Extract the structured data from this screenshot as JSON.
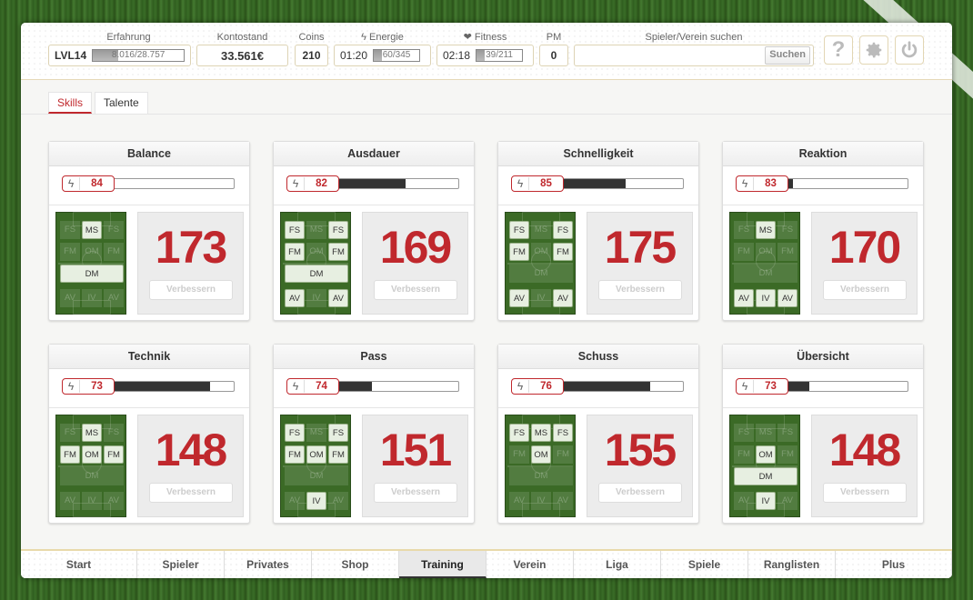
{
  "header": {
    "erfahrung": {
      "label": "Erfahrung",
      "level": "LVL14",
      "bar_text": "8.016/28.757",
      "progress": 0.279
    },
    "kontostand": {
      "label": "Kontostand",
      "value": "33.561€"
    },
    "coins": {
      "label": "Coins",
      "value": "210"
    },
    "energie": {
      "label": "Energie",
      "icon": "lightning-icon",
      "time": "01:20",
      "bar_text": "60/345",
      "progress": 0.174
    },
    "fitness": {
      "label": "Fitness",
      "icon": "heart-icon",
      "time": "02:18",
      "bar_text": "39/211",
      "progress": 0.185
    },
    "pm": {
      "label": "PM",
      "value": "0"
    },
    "search": {
      "label": "Spieler/Verein suchen",
      "value": "",
      "button": "Suchen"
    },
    "icons": [
      "help-icon",
      "settings-gear-icon",
      "power-icon"
    ]
  },
  "subtabs": [
    {
      "label": "Skills",
      "active": true
    },
    {
      "label": "Talente",
      "active": false
    }
  ],
  "improve_label": "Verbessern",
  "skills": [
    {
      "title": "Balance",
      "level": "84",
      "progress": 0.05,
      "value": "173",
      "positions": {
        "LF": false,
        "MS": true,
        "RF": false,
        "LM": false,
        "OM": false,
        "RM": false,
        "DM": true,
        "LV": false,
        "IV": false,
        "RV": false
      }
    },
    {
      "title": "Ausdauer",
      "level": "82",
      "progress": 0.58,
      "value": "169",
      "positions": {
        "LF": true,
        "MS": false,
        "RF": true,
        "LM": true,
        "OM": false,
        "RM": true,
        "DM": true,
        "LV": true,
        "IV": false,
        "RV": true
      }
    },
    {
      "title": "Schnelligkeit",
      "level": "85",
      "progress": 0.54,
      "value": "175",
      "positions": {
        "LF": true,
        "MS": false,
        "RF": true,
        "LM": true,
        "OM": false,
        "RM": true,
        "DM": false,
        "LV": true,
        "IV": false,
        "RV": true
      }
    },
    {
      "title": "Reaktion",
      "level": "83",
      "progress": 0.09,
      "value": "170",
      "positions": {
        "LF": false,
        "MS": true,
        "RF": false,
        "LM": false,
        "OM": false,
        "RM": false,
        "DM": false,
        "LV": true,
        "IV": true,
        "RV": true
      }
    },
    {
      "title": "Technik",
      "level": "73",
      "progress": 0.81,
      "value": "148",
      "positions": {
        "LF": false,
        "MS": true,
        "RF": false,
        "LM": true,
        "OM": true,
        "RM": true,
        "DM": false,
        "LV": false,
        "IV": false,
        "RV": false
      }
    },
    {
      "title": "Pass",
      "level": "74",
      "progress": 0.31,
      "value": "151",
      "positions": {
        "LF": true,
        "MS": false,
        "RF": true,
        "LM": true,
        "OM": true,
        "RM": true,
        "DM": false,
        "LV": false,
        "IV": true,
        "RV": false
      }
    },
    {
      "title": "Schuss",
      "level": "76",
      "progress": 0.74,
      "value": "155",
      "positions": {
        "LF": true,
        "MS": true,
        "RF": true,
        "LM": false,
        "OM": true,
        "RM": false,
        "DM": false,
        "LV": false,
        "IV": false,
        "RV": false
      }
    },
    {
      "title": "Übersicht",
      "level": "73",
      "progress": 0.22,
      "value": "148",
      "positions": {
        "LF": false,
        "MS": false,
        "RF": false,
        "LM": false,
        "OM": true,
        "RM": false,
        "DM": true,
        "LV": false,
        "IV": true,
        "RV": false
      }
    }
  ],
  "position_labels": {
    "LF": "FS",
    "MS": "MS",
    "RF": "FS",
    "LM": "FM",
    "OM": "OM",
    "RM": "FM",
    "DM": "DM",
    "LV": "AV",
    "IV": "IV",
    "RV": "AV"
  },
  "nav": [
    {
      "label": "Start",
      "active": false
    },
    {
      "label": "Spieler",
      "active": false
    },
    {
      "label": "Privates",
      "active": false
    },
    {
      "label": "Shop",
      "active": false
    },
    {
      "label": "Training",
      "active": true
    },
    {
      "label": "Verein",
      "active": false
    },
    {
      "label": "Liga",
      "active": false
    },
    {
      "label": "Spiele",
      "active": false
    },
    {
      "label": "Ranglisten",
      "active": false
    },
    {
      "label": "Plus",
      "active": false
    }
  ],
  "colors": {
    "accent": "#c0282d",
    "pitch": "#3b6a26"
  }
}
